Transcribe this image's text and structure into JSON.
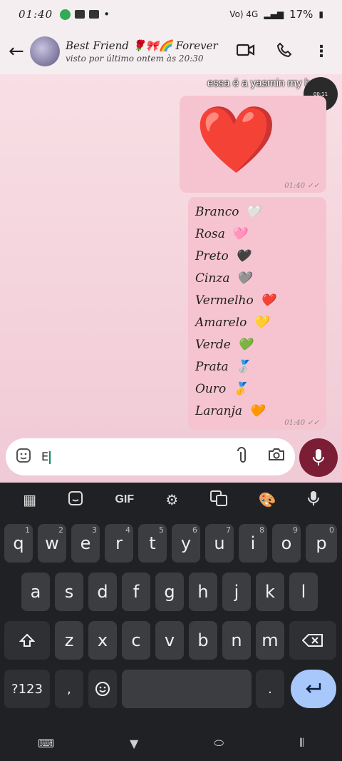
{
  "status": {
    "time": "01:40",
    "network": "Vo) 4G",
    "battery": "17%"
  },
  "header": {
    "contact_name": "Best Friend 🌹🎀🌈 Forever",
    "last_seen": "visto por último ontem às 20:30"
  },
  "chat": {
    "overlay_caption": "essa é a yasmin my best 🎀",
    "pip_time": "00:11",
    "messages": [
      {
        "content": "❤️",
        "time": "01:40"
      },
      {
        "time": "01:40",
        "lines": [
          {
            "text": "Branco",
            "emoji": "🤍"
          },
          {
            "text": "Rosa",
            "emoji": "🩷"
          },
          {
            "text": "Preto",
            "emoji": "🖤"
          },
          {
            "text": "Cinza",
            "emoji": "🩶"
          },
          {
            "text": "Vermelho",
            "emoji": "❤️"
          },
          {
            "text": "Amarelo",
            "emoji": "💛"
          },
          {
            "text": "Verde",
            "emoji": "💚"
          },
          {
            "text": "Prata",
            "emoji": "🥈"
          },
          {
            "text": "Ouro",
            "emoji": "🥇"
          },
          {
            "text": "Laranja",
            "emoji": "🧡"
          }
        ]
      }
    ]
  },
  "input": {
    "value": "E"
  },
  "keyboard": {
    "toolbar": [
      "apps-grid-icon",
      "sticker-icon",
      "GIF",
      "gear-icon",
      "translate-icon",
      "palette-icon",
      "mic-icon"
    ],
    "gif_label": "GIF",
    "row1": [
      {
        "k": "q",
        "h": "1"
      },
      {
        "k": "w",
        "h": "2"
      },
      {
        "k": "e",
        "h": "3"
      },
      {
        "k": "r",
        "h": "4"
      },
      {
        "k": "t",
        "h": "5"
      },
      {
        "k": "y",
        "h": "6"
      },
      {
        "k": "u",
        "h": "7"
      },
      {
        "k": "i",
        "h": "8"
      },
      {
        "k": "o",
        "h": "9"
      },
      {
        "k": "p",
        "h": "0"
      }
    ],
    "row2": [
      "a",
      "s",
      "d",
      "f",
      "g",
      "h",
      "j",
      "k",
      "l"
    ],
    "row3": [
      "z",
      "x",
      "c",
      "v",
      "b",
      "n",
      "m"
    ],
    "symbols_label": "?123",
    "comma_label": ",",
    "period_label": "."
  },
  "colors": {
    "bubble": "#f6c4d0",
    "mic_button": "#7b1d34",
    "enter_key": "#a8c7fa"
  }
}
